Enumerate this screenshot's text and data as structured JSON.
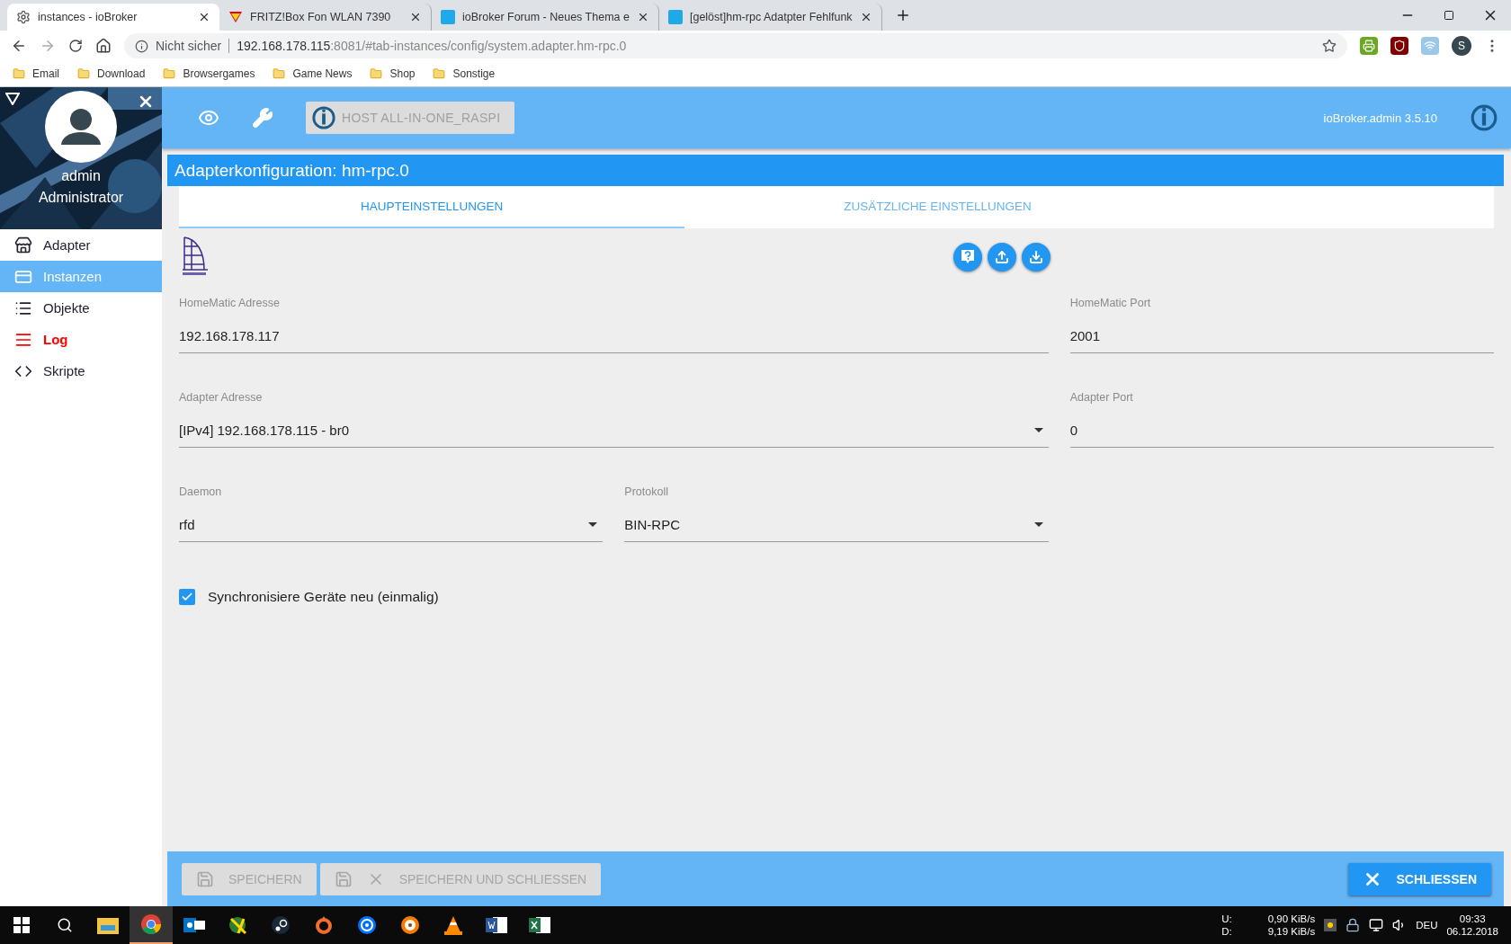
{
  "browser": {
    "tabs": [
      {
        "title": "instances - ioBroker",
        "kind": "settings",
        "selected": true
      },
      {
        "title": "FRITZ!Box Fon WLAN 7390",
        "kind": "fritz",
        "selected": false
      },
      {
        "title": "ioBroker Forum - Neues Thema e",
        "kind": "io",
        "selected": false
      },
      {
        "title": "[gelöst]hm-rpc Adatpter Fehlfunk",
        "kind": "io",
        "selected": false
      }
    ],
    "security": "Nicht sicher",
    "host": "192.168.178.115",
    "path": ":8081/#tab-instances/config/system.adapter.hm-rpc.0",
    "profile": "S",
    "bookmarks": [
      "Email",
      "Download",
      "Browsergames",
      "Game News",
      "Shop",
      "Sonstige"
    ]
  },
  "sidebar": {
    "user": "admin",
    "role": "Administrator",
    "items": [
      {
        "label": "Adapter",
        "kind": "store",
        "selected": false,
        "warning": false
      },
      {
        "label": "Instanzen",
        "kind": "card",
        "selected": true,
        "warning": false
      },
      {
        "label": "Objekte",
        "kind": "list",
        "selected": false,
        "warning": false
      },
      {
        "label": "Log",
        "kind": "lines",
        "selected": false,
        "warning": true
      },
      {
        "label": "Skripte",
        "kind": "code",
        "selected": false,
        "warning": false
      }
    ]
  },
  "header": {
    "host": "HOST ALL-IN-ONE_RASPI",
    "host_disabled": true,
    "version": "ioBroker.admin 3.5.10"
  },
  "dialog": {
    "title": "Adapterkonfiguration: hm-rpc.0",
    "tabs": [
      {
        "label": "HAUPTEINSTELLUNGEN",
        "selected": true
      },
      {
        "label": "ZUSÄTZLICHE EINSTELLUNGEN",
        "selected": false
      }
    ],
    "rows": [
      {
        "fields": [
          {
            "label": "HomeMatic Adresse",
            "value": "192.168.178.117",
            "kind": "text"
          },
          {
            "label": "HomeMatic Port",
            "value": "2001",
            "kind": "text"
          }
        ]
      },
      {
        "fields": [
          {
            "label": "Adapter Adresse",
            "value": "[IPv4] 192.168.178.115 - br0",
            "kind": "select"
          },
          {
            "label": "Adapter Port",
            "value": "0",
            "kind": "text"
          }
        ]
      },
      {
        "fields": [
          {
            "label": "Daemon",
            "value": "rfd",
            "kind": "select"
          },
          {
            "label": "Protokoll",
            "value": "BIN-RPC",
            "kind": "select"
          }
        ]
      }
    ],
    "checkbox": {
      "label": "Synchronisiere Geräte neu (einmalig)",
      "checked": true
    },
    "buttons": [
      {
        "label": "SPEICHERN",
        "kind": "save",
        "disabled": true
      },
      {
        "label": "SPEICHERN UND SCHLIESSEN",
        "kind": "save_close",
        "disabled": true
      },
      {
        "label": "SCHLIESSEN",
        "kind": "close",
        "disabled": false
      }
    ]
  },
  "taskbar": {
    "apps": [
      {
        "kind": "folder",
        "selected": false
      },
      {
        "kind": "chrome",
        "selected": true
      },
      {
        "kind": "mail",
        "selected": false
      },
      {
        "kind": "globe",
        "selected": false
      },
      {
        "kind": "steam",
        "selected": false
      },
      {
        "kind": "origin",
        "selected": false
      },
      {
        "kind": "uplay",
        "selected": false
      },
      {
        "kind": "disc",
        "selected": false
      },
      {
        "kind": "cone",
        "selected": false
      },
      {
        "kind": "word",
        "selected": false
      },
      {
        "kind": "excel",
        "selected": false
      }
    ],
    "up_label": "U:",
    "down_label": "D:",
    "up_rate": "0,90 KiB/s",
    "down_rate": "9,19 KiB/s",
    "language": "DEU",
    "time": "09:33",
    "date": "06.12.2018"
  }
}
